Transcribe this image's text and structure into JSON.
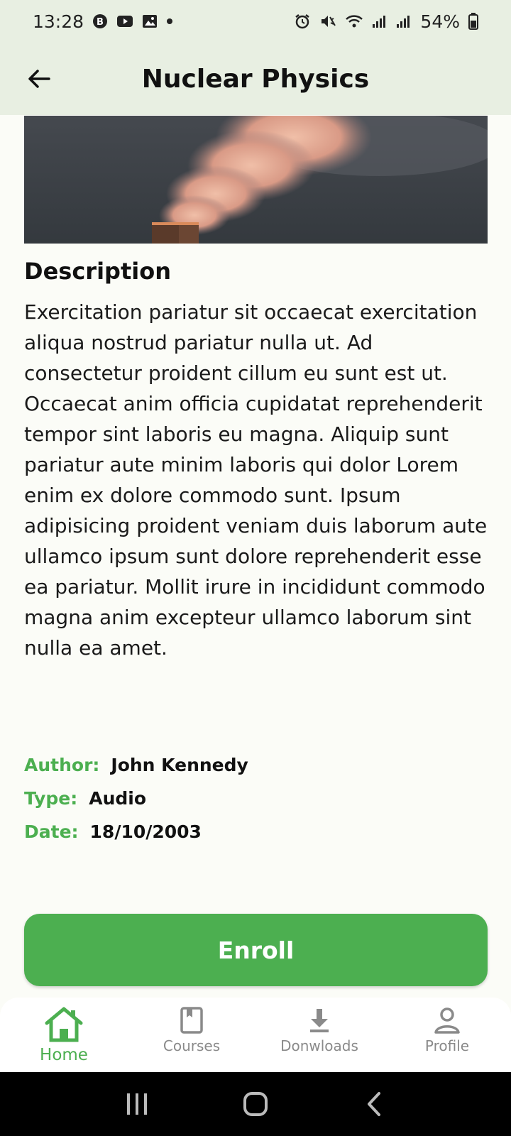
{
  "status_bar": {
    "time": "13:28",
    "battery": "54%",
    "left_icons": [
      "b-app-icon",
      "youtube-icon",
      "gallery-icon",
      "dot-icon"
    ],
    "right_icons": [
      "alarm-icon",
      "mute-icon",
      "wifi-icon",
      "signal-icon",
      "signal-icon",
      "battery-icon"
    ]
  },
  "header": {
    "title": "Nuclear Physics",
    "back_icon": "arrow-left-icon"
  },
  "hero": {
    "image": "cooling-towers-smoke-photo"
  },
  "description": {
    "title": "Description",
    "text": "Exercitation pariatur sit occaecat exercitation aliqua nostrud pariatur nulla ut. Ad consectetur proident cillum eu sunt est ut. Occaecat anim officia cupidatat reprehenderit tempor sint laboris eu magna. Aliquip sunt pariatur aute minim laboris qui dolor Lorem enim ex dolore commodo sunt. Ipsum adipisicing proident veniam duis laborum aute ullamco ipsum sunt dolore reprehenderit esse ea pariatur. Mollit irure in incididunt commodo magna anim excepteur ullamco laborum sint nulla ea amet."
  },
  "details": {
    "author_label": "Author:",
    "author": "John Kennedy",
    "type_label": "Type:",
    "type": "Audio",
    "date_label": "Date:",
    "date": "18/10/2003"
  },
  "enroll_label": "Enroll",
  "bottom_nav": {
    "items": [
      {
        "label": "Home",
        "icon": "home-icon",
        "active": true
      },
      {
        "label": "Courses",
        "icon": "book-icon",
        "active": false
      },
      {
        "label": "Donwloads",
        "icon": "download-icon",
        "active": false
      },
      {
        "label": "Profile",
        "icon": "person-icon",
        "active": false
      }
    ]
  },
  "colors": {
    "accent": "#4caf50",
    "app_bar": "#e8efe2",
    "background": "#fbfcf7"
  }
}
